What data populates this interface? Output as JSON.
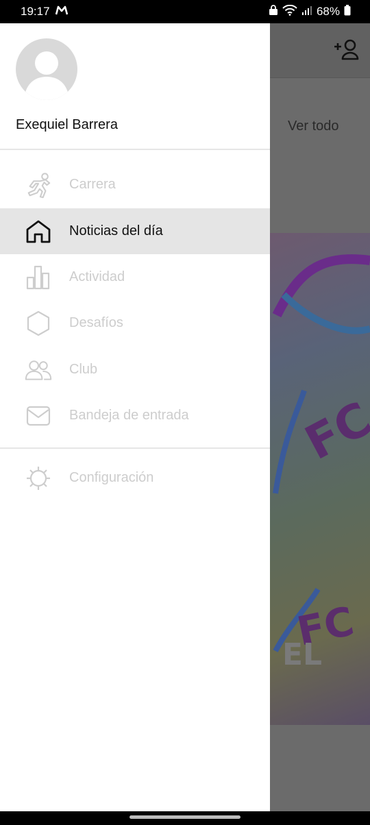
{
  "status_bar": {
    "time": "19:17",
    "battery": "68%",
    "icons": [
      "app-notification-icon",
      "lock-icon",
      "wifi-icon",
      "signal-icon",
      "battery-icon"
    ]
  },
  "background_screen": {
    "see_all_label": "Ver todo",
    "image_text": "EL",
    "image_marks": [
      "FC",
      "FC"
    ]
  },
  "drawer": {
    "user_name": "Exequiel Barrera",
    "menu": [
      {
        "label": "Carrera",
        "icon": "runner-icon",
        "active": false
      },
      {
        "label": "Noticias del día",
        "icon": "home-icon",
        "active": true
      },
      {
        "label": "Actividad",
        "icon": "bar-chart-icon",
        "active": false
      },
      {
        "label": "Desafíos",
        "icon": "hexagon-icon",
        "active": false
      },
      {
        "label": "Club",
        "icon": "people-icon",
        "active": false
      },
      {
        "label": "Bandeja de entrada",
        "icon": "envelope-icon",
        "active": false
      }
    ],
    "settings_label": "Configuración"
  },
  "colors": {
    "active_bg": "#e5e5e5",
    "inactive_text": "#cdcdcd",
    "active_text": "#111111",
    "scrim": "#6b6b6b"
  }
}
